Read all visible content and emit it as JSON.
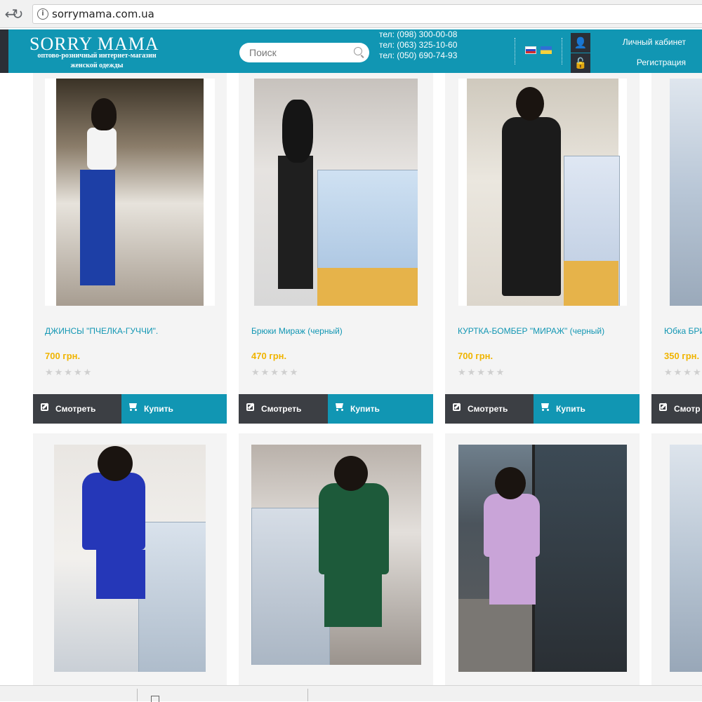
{
  "browser": {
    "url": "sorrymama.com.ua",
    "back_glyph": "←",
    "reload_glyph": "↻",
    "info_glyph": "i"
  },
  "header": {
    "logo_title": "SORRY MAMA",
    "logo_sub1": "оптово-розничный интернет-магазин",
    "logo_sub2": "женской одежды",
    "search_placeholder": "Поиск",
    "phones": [
      "тел: (098) 300-00-08",
      "тел: (063) 325-10-60",
      "тел: (050) 690-74-93"
    ],
    "account_label": "Личный кабинет",
    "register_label": "Регистрация",
    "user_glyph": "👤",
    "lock_glyph": "🔓",
    "colors": {
      "header_bg": "#1196b3",
      "dark": "#2b2f36",
      "price": "#f0b400"
    }
  },
  "products": [
    {
      "title": "ДЖИНСЫ \"ПЧЕЛКА-ГУЧЧИ\".",
      "price": "700 грн.",
      "stars": "★★★★★",
      "view_label": "Смотреть",
      "buy_label": "Купить"
    },
    {
      "title": "Брюки Мираж (черный)",
      "price": "470 грн.",
      "stars": "★★★★★",
      "view_label": "Смотреть",
      "buy_label": "Купить"
    },
    {
      "title": "КУРТКА-БОМБЕР \"МИРАЖ\" (черный)",
      "price": "700 грн.",
      "stars": "★★★★★",
      "view_label": "Смотреть",
      "buy_label": "Купить"
    },
    {
      "title": "Юбка БРИ",
      "price": "350 грн.",
      "stars": "★★★★★",
      "view_label": "Смотр",
      "buy_label": ""
    }
  ]
}
